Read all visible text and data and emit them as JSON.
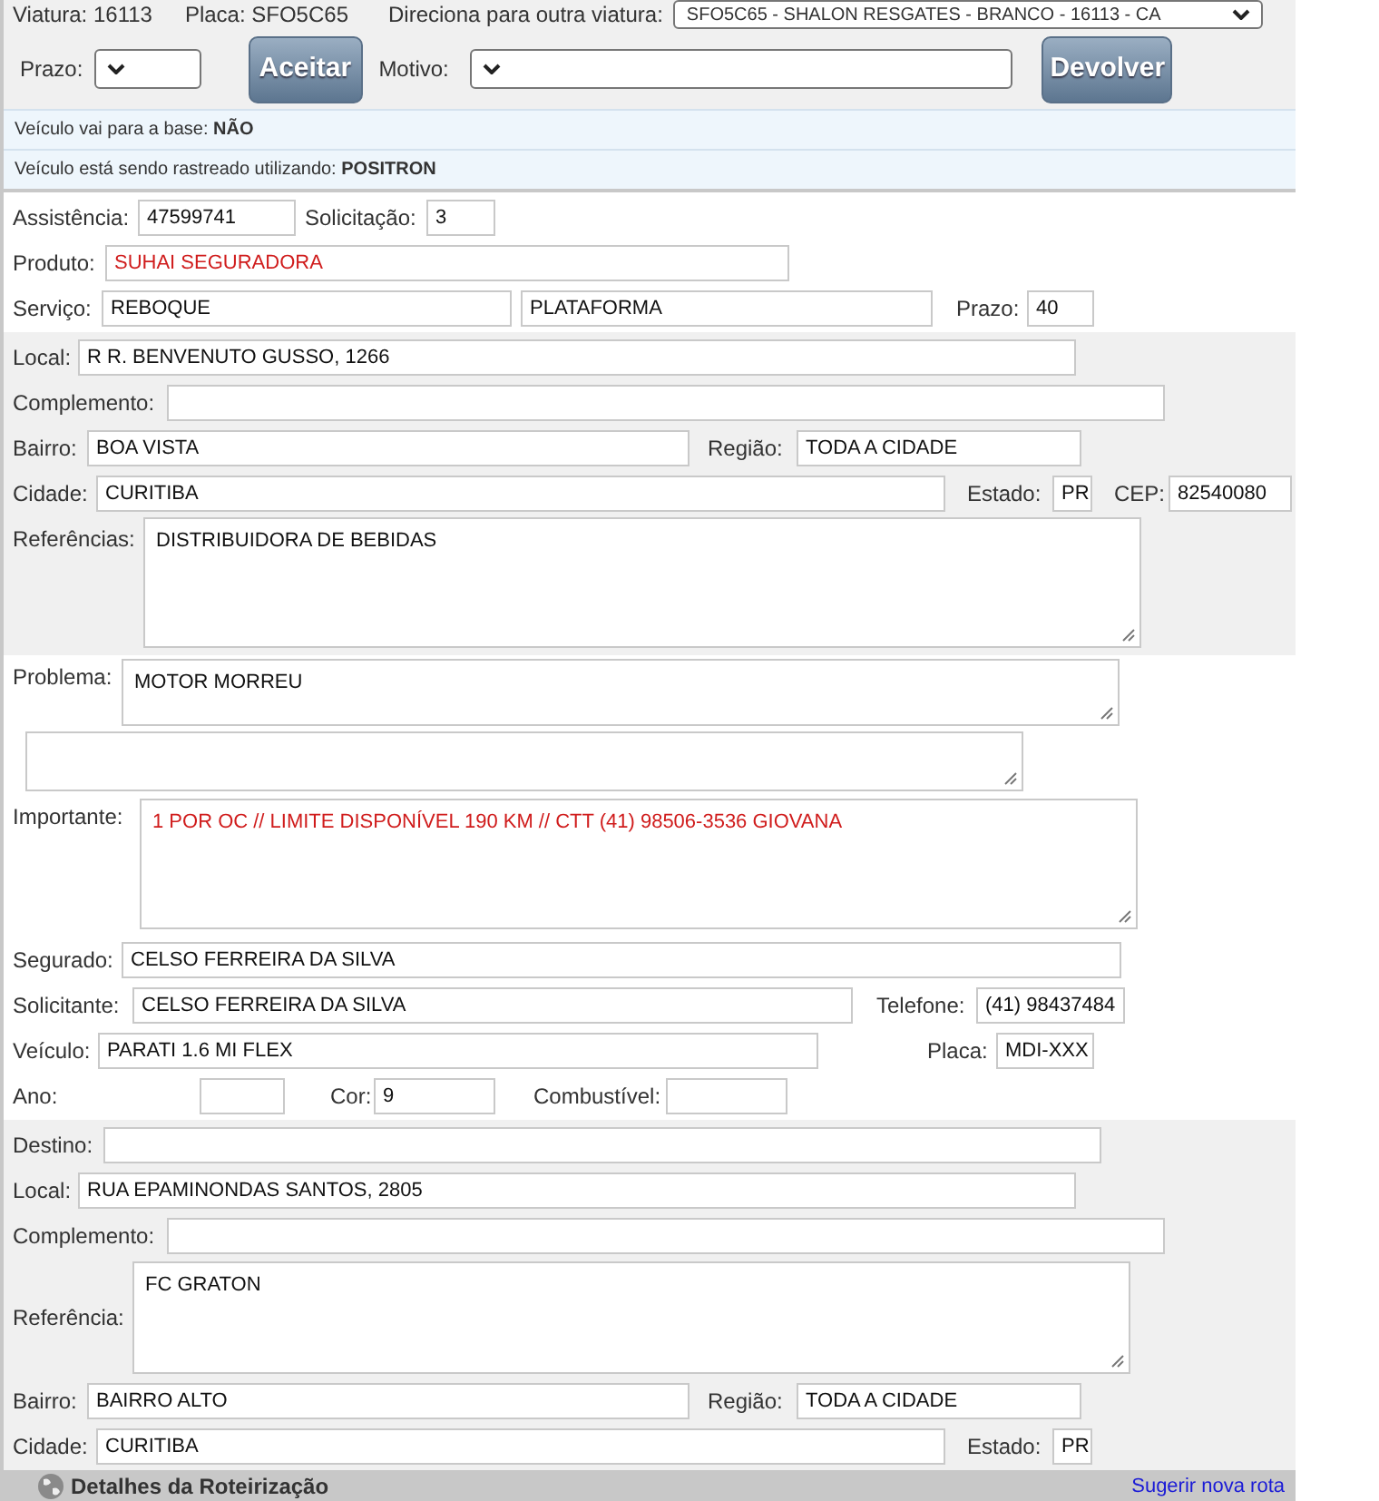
{
  "vehicle": {
    "viatura": "Viatura: 16113",
    "placa": "Placa: SFO5C65",
    "redirect_label": "Direciona para outra viatura:",
    "redirect_value": "SFO5C65 - SHALON RESGATES - BRANCO - 16113 - CA"
  },
  "actions": {
    "prazo_label": "Prazo:",
    "accept": "Aceitar",
    "motivo_label": "Motivo:",
    "return": "Devolver"
  },
  "info": [
    "Veículo vai para a base: **NÃO**",
    "Veículo está sendo rastreado utilizando: **POSITRON**"
  ],
  "sections": [
    {
      "shaded": false,
      "rows": [
        {
          "fields": [
            {
              "label": "Assistência:",
              "value": "47599741",
              "kind": "input",
              "alert": false
            },
            {
              "label": "Solicitação:",
              "value": "3",
              "kind": "input",
              "alert": false
            }
          ]
        },
        {
          "fields": [
            {
              "label": "Produto:",
              "value": "SUHAI SEGURADORA",
              "kind": "input",
              "alert": true
            }
          ]
        },
        {
          "fields": [
            {
              "label": "Serviço:",
              "value": "REBOQUE",
              "kind": "input",
              "alert": false
            },
            {
              "value": "PLATAFORMA",
              "kind": "input",
              "alert": false
            },
            {
              "label": "Prazo:",
              "value": "40",
              "kind": "input",
              "alert": false
            }
          ]
        }
      ]
    },
    {
      "shaded": true,
      "rows": [
        {
          "fields": [
            {
              "label": "Local:",
              "value": "R R. BENVENUTO GUSSO, 1266",
              "kind": "input",
              "alert": false
            }
          ]
        },
        {
          "fields": [
            {
              "label": "Complemento:",
              "kind": "input"
            }
          ]
        },
        {
          "fields": [
            {
              "label": "Bairro:",
              "value": "BOA VISTA",
              "kind": "input",
              "alert": false
            },
            {
              "label": "Região:",
              "value": "TODA A CIDADE",
              "kind": "input",
              "alert": false
            }
          ]
        },
        {
          "fields": [
            {
              "label": "Cidade:",
              "value": "CURITIBA",
              "kind": "input",
              "alert": false
            },
            {
              "label": "Estado:",
              "value": "PR",
              "kind": "input",
              "alert": false
            },
            {
              "label": "CEP:",
              "value": "82540080",
              "kind": "input",
              "alert": false
            }
          ]
        },
        {
          "fields": [
            {
              "label": "Referências:",
              "value": "DISTRIBUIDORA DE BEBIDAS",
              "kind": "textarea",
              "alert": false
            }
          ]
        }
      ]
    },
    {
      "shaded": false,
      "rows": [
        {
          "fields": [
            {
              "label": "Problema:",
              "value": "MOTOR MORREU",
              "kind": "textarea",
              "alert": false
            }
          ]
        },
        {
          "fields": [
            {
              "kind": "textarea"
            }
          ]
        },
        {
          "fields": [
            {
              "label": "Importante:",
              "value": "1 POR OC // LIMITE DISPONÍVEL 190 KM // CTT (41) 98506-3536 GIOVANA",
              "kind": "textarea",
              "alert": true
            }
          ]
        },
        {
          "fields": [
            {
              "label": "Segurado:",
              "value": "CELSO FERREIRA DA SILVA",
              "kind": "input",
              "alert": false
            }
          ]
        },
        {
          "fields": [
            {
              "label": "Solicitante:",
              "value": "CELSO FERREIRA DA SILVA",
              "kind": "input",
              "alert": false
            },
            {
              "label": "Telefone:",
              "value": "(41) 98437484",
              "kind": "input",
              "alert": false
            }
          ]
        },
        {
          "fields": [
            {
              "label": "Veículo:",
              "value": "PARATI 1.6 MI FLEX",
              "kind": "input",
              "alert": false
            },
            {
              "label": "Placa:",
              "value": "MDI-XXX",
              "kind": "input",
              "alert": false
            }
          ]
        },
        {
          "fields": [
            {
              "label": "Ano:",
              "kind": "input"
            },
            {
              "label": "Cor:",
              "value": "9",
              "kind": "input",
              "alert": false
            },
            {
              "label": "Combustível:",
              "kind": "input"
            }
          ]
        }
      ]
    },
    {
      "shaded": true,
      "rows": [
        {
          "fields": [
            {
              "label": "Destino:",
              "kind": "input"
            }
          ]
        },
        {
          "fields": [
            {
              "label": "Local:",
              "value": "RUA EPAMINONDAS SANTOS, 2805",
              "kind": "input",
              "alert": false
            }
          ]
        },
        {
          "fields": [
            {
              "label": "Complemento:",
              "kind": "input"
            }
          ]
        },
        {
          "fields": [
            {
              "label": "Referência:",
              "value": "FC GRATON",
              "kind": "textarea",
              "alert": false
            }
          ]
        },
        {
          "fields": [
            {
              "label": "Bairro:",
              "value": "BAIRRO ALTO",
              "kind": "input",
              "alert": false
            },
            {
              "label": "Região:",
              "value": "TODA A CIDADE",
              "kind": "input",
              "alert": false
            }
          ]
        },
        {
          "fields": [
            {
              "label": "Cidade:",
              "value": "CURITIBA",
              "kind": "input",
              "alert": false
            },
            {
              "label": "Estado:",
              "value": "PR",
              "kind": "input",
              "alert": false
            }
          ]
        }
      ]
    }
  ],
  "routing": {
    "title": "Detalhes da Roteirização",
    "link": "Sugerir nova rota"
  }
}
